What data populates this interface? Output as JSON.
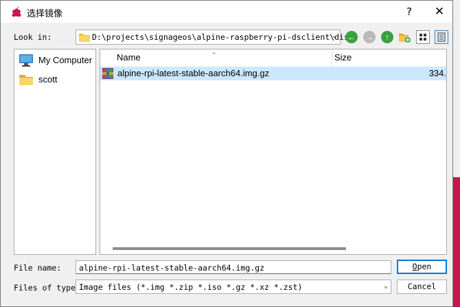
{
  "window": {
    "title": "选择镜像",
    "help_label": "?",
    "close_label": "✕"
  },
  "toolbar": {
    "lookin_label": "Look in:",
    "path": "D:\\projects\\signageos\\alpine-raspberry-pi-dsclient\\dist",
    "icons": [
      "back-icon",
      "forward-icon",
      "parent-folder-icon",
      "new-folder-icon",
      "detail-view-icon",
      "list-view-icon"
    ]
  },
  "sidebar": {
    "items": [
      {
        "label": "My Computer",
        "icon": "computer-icon"
      },
      {
        "label": "scott",
        "icon": "folder-icon"
      }
    ]
  },
  "filelist": {
    "columns": [
      "Name",
      "Size"
    ],
    "rows": [
      {
        "name": "alpine-rpi-latest-stable-aarch64.img.gz",
        "size": "334.",
        "icon": "archive-icon",
        "selected": true
      }
    ]
  },
  "footer": {
    "filename_label": "File name:",
    "filename_value": "alpine-rpi-latest-stable-aarch64.img.gz",
    "filetype_label": "Files of type:",
    "filetype_value": "Image files (*.img *.zip *.iso *.gz *.xz *.zst)",
    "open_label_underlined": "O",
    "open_label_rest": "pen",
    "cancel_label": "Cancel"
  },
  "colors": {
    "selection": "#cce8ff",
    "accent": "#0078d7",
    "nav_green": "#3aa040",
    "brand_red": "#c8174c"
  }
}
